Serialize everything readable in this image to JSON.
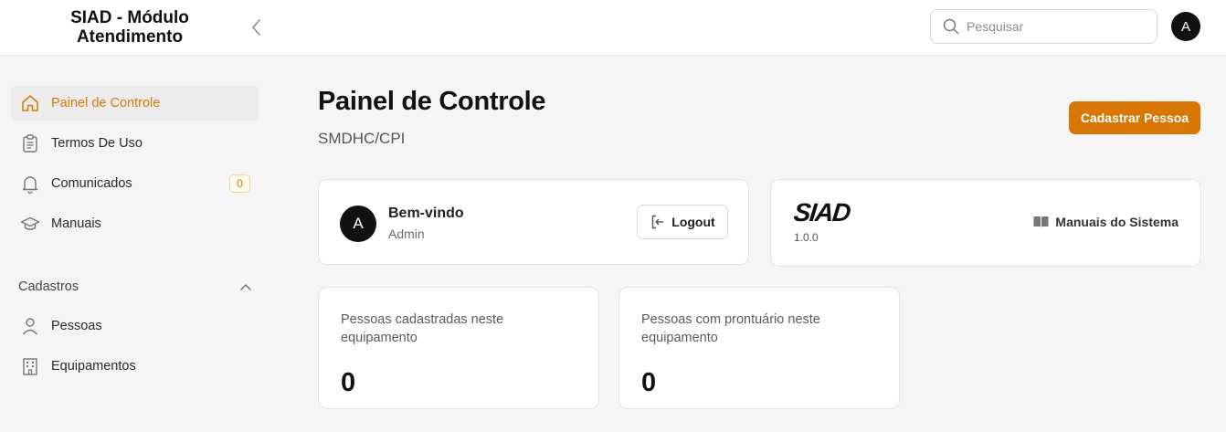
{
  "header": {
    "brand_line1": "SIAD - Módulo",
    "brand_line2": "Atendimento",
    "search_placeholder": "Pesquisar",
    "avatar_initial": "A"
  },
  "sidebar": {
    "items": [
      {
        "label": "Painel de Controle",
        "icon": "home-icon",
        "active": true
      },
      {
        "label": "Termos De Uso",
        "icon": "clipboard-icon"
      },
      {
        "label": "Comunicados",
        "icon": "bell-icon",
        "badge": "0"
      },
      {
        "label": "Manuais",
        "icon": "graduation-cap-icon"
      }
    ],
    "section": {
      "label": "Cadastros",
      "items": [
        {
          "label": "Pessoas",
          "icon": "user-icon"
        },
        {
          "label": "Equipamentos",
          "icon": "building-icon"
        }
      ]
    }
  },
  "main": {
    "title": "Painel de Controle",
    "subtitle": "SMDHC/CPI",
    "primary_button": "Cadastrar Pessoa",
    "welcome": {
      "avatar_initial": "A",
      "greeting": "Bem-vindo",
      "role": "Admin",
      "logout_label": "Logout"
    },
    "system": {
      "logo_text": "SIAD",
      "version": "1.0.0",
      "manuals_link": "Manuais do Sistema"
    },
    "stats": [
      {
        "label": "Pessoas cadastradas neste equipamento",
        "value": "0"
      },
      {
        "label": "Pessoas com prontuário neste equipamento",
        "value": "0"
      }
    ]
  },
  "colors": {
    "accent": "#d97706",
    "background": "#f5f5f5",
    "card": "#ffffff"
  }
}
